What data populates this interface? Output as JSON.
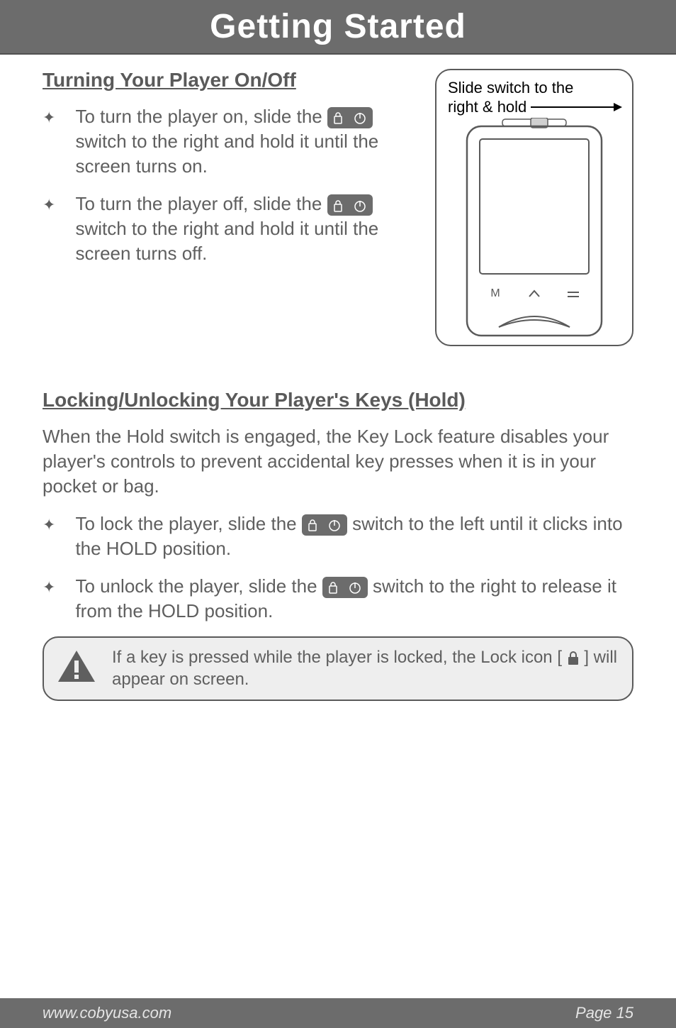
{
  "title": "Getting Started",
  "section1": {
    "heading": "Turning Your Player On/Off",
    "items": [
      {
        "pre": "To turn the player on, slide the ",
        "post": " switch to the right and hold it until the screen turns on."
      },
      {
        "pre": "To turn the player off, slide the ",
        "post": " switch to the right and hold it until the screen turns off."
      }
    ]
  },
  "diagram": {
    "line1": "Slide switch to the",
    "line2": "right & hold"
  },
  "section2": {
    "heading": "Locking/Unlocking Your Player's Keys (Hold)",
    "para": "When the Hold switch is engaged, the Key Lock feature disables your player's controls to prevent accidental key presses when it is in your pocket or bag.",
    "items": [
      {
        "pre": "To lock the player, slide the ",
        "post": " switch to the left until it clicks into the HOLD position."
      },
      {
        "pre": "To unlock the player, slide the ",
        "post": " switch to the right to release it from the HOLD position."
      }
    ]
  },
  "note": {
    "pre": "If a key is pressed while the player is locked, the Lock icon [ ",
    "post": " ] will appear on screen."
  },
  "footer": {
    "url": "www.cobyusa.com",
    "page": "Page 15"
  }
}
